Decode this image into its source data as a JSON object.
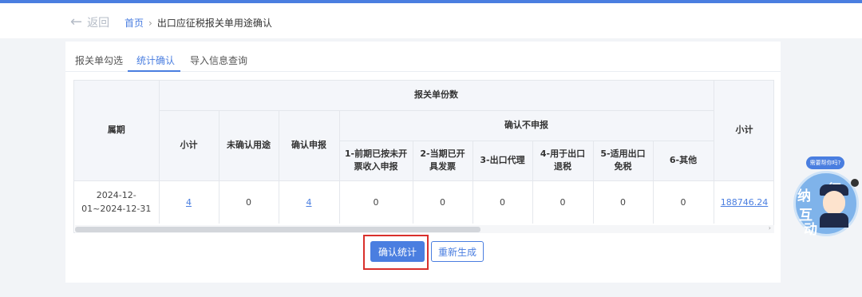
{
  "header": {
    "back_label": "返回",
    "breadcrumb_home": "首页",
    "breadcrumb_separator": "›",
    "breadcrumb_current": "出口应征税报关单用途确认"
  },
  "tabs": [
    {
      "label": "报关单勾选",
      "active": false
    },
    {
      "label": "统计确认",
      "active": true
    },
    {
      "label": "导入信息查询",
      "active": false
    }
  ],
  "table": {
    "col_period": "属期",
    "group_count": "报关单份数",
    "col_subtotal": "小计",
    "col_unconfirmed": "未确认用途",
    "col_confirmed_declare": "确认申报",
    "group_no_declare": "确认不申报",
    "sub_cols": [
      "1-前期已按未开票收入申报",
      "2-当期已开具发票",
      "3-出口代理",
      "4-用于出口退税",
      "5-适用出口免税",
      "6-其他"
    ],
    "col_amount_subtotal": "小计",
    "rows": [
      {
        "period": "2024-12-01~2024-12-31",
        "subtotal": "4",
        "unconfirmed": "0",
        "confirmed_declare": "4",
        "c1": "0",
        "c2": "0",
        "c3": "0",
        "c4": "0",
        "c5": "0",
        "c6": "0",
        "amount_subtotal": "188746.24"
      }
    ]
  },
  "buttons": {
    "confirm_stats": "确认统计",
    "regenerate": "重新生成"
  },
  "widget": {
    "bubble": "需要帮你吗?",
    "chars": [
      "征",
      "纳",
      "互",
      "动"
    ]
  },
  "colors": {
    "accent": "#4a7ee0",
    "highlight": "#d9302c"
  }
}
